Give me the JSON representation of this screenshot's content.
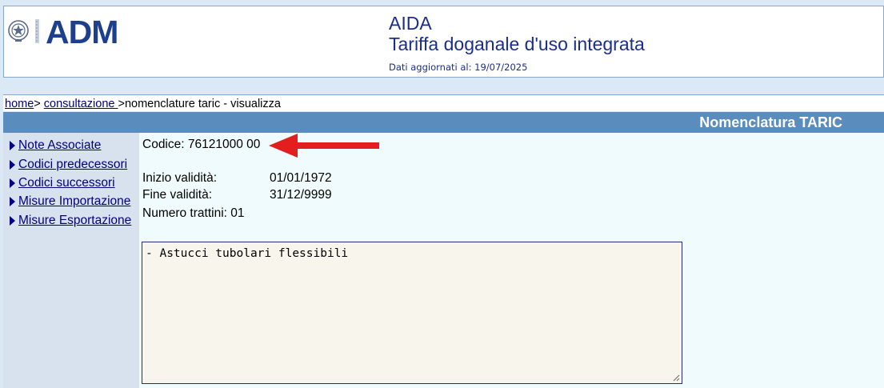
{
  "header": {
    "logo_text": "ADM",
    "app_title": "AIDA",
    "app_subtitle": "Tariffa doganale d'uso integrata",
    "updated_label": "Dati aggiornati al: 19/07/2025"
  },
  "breadcrumb": {
    "home": "home",
    "sep1": ">",
    "consultazione": "consultazione ",
    "current": ">nomenclature taric - visualizza"
  },
  "section": {
    "title": "Nomenclatura TARIC"
  },
  "sidebar": {
    "items": [
      {
        "label": "Note Associate"
      },
      {
        "label": "Codici predecessori"
      },
      {
        "label": "Codici successori"
      },
      {
        "label": "Misure Importazione"
      },
      {
        "label": "Misure Esportazione"
      }
    ]
  },
  "record": {
    "code_label": "Codice: 76121000 00",
    "start_label": "Inizio validità:",
    "start_value": "01/01/1972",
    "end_label": "Fine validità:",
    "end_value": "31/12/9999",
    "dashes_label": "Numero trattini: 01",
    "description": "- Astucci tubolari flessibili"
  },
  "colors": {
    "header_text": "#1b2d8f",
    "section_bar": "#5a8cbd",
    "arrow": "#e21e1e"
  }
}
